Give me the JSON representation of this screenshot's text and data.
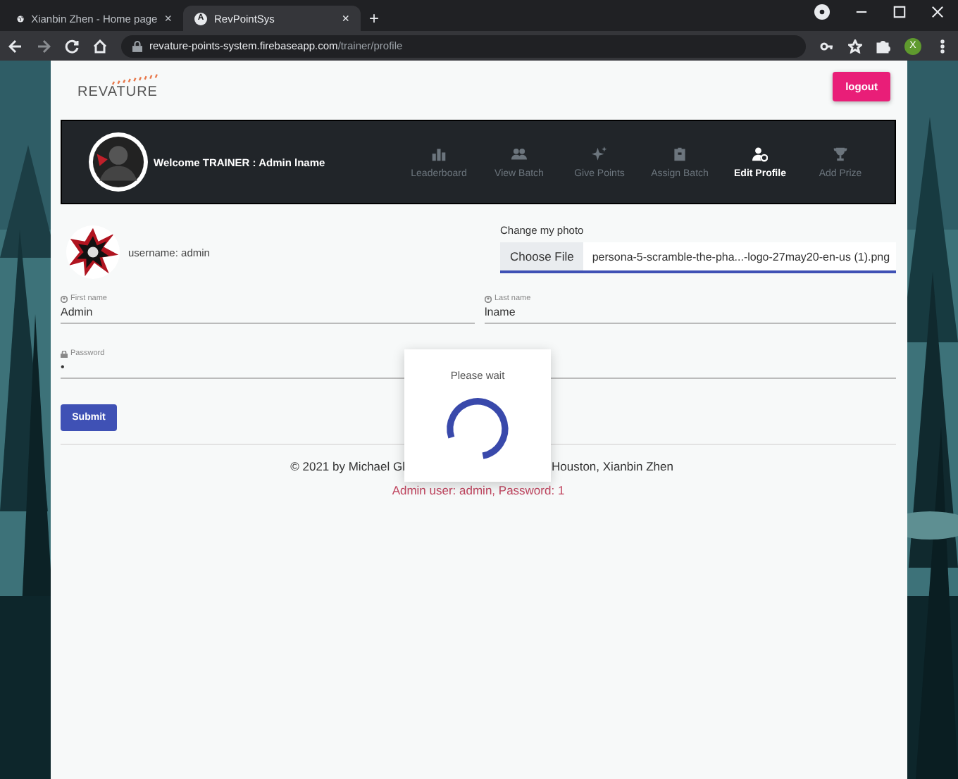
{
  "browser": {
    "tabs": [
      {
        "title": "Xianbin Zhen - Home page",
        "close": "×",
        "selected": false
      },
      {
        "title": "RevPointSys",
        "favicon": "A",
        "close": "×",
        "selected": true
      }
    ],
    "new_tab": "+",
    "url": {
      "host": "revature-points-system.firebaseapp.com",
      "path": "/trainer/profile"
    },
    "profile": "X"
  },
  "header": {
    "logo": "REVATURE",
    "logout": "logout"
  },
  "navbar": {
    "welcome": "Welcome TRAINER : Admin lname",
    "items": [
      {
        "label": "Leaderboard",
        "kind": "chart",
        "selected": false
      },
      {
        "label": "View Batch",
        "kind": "people",
        "selected": false
      },
      {
        "label": "Give Points",
        "kind": "sparkle",
        "selected": false
      },
      {
        "label": "Assign Batch",
        "kind": "clipboard",
        "selected": false
      },
      {
        "label": "Edit Profile",
        "kind": "person-gear",
        "selected": true
      },
      {
        "label": "Add Prize",
        "kind": "trophy",
        "selected": false
      }
    ]
  },
  "profile": {
    "username": "username: admin",
    "photo_label": "Change my photo",
    "choose_file": "Choose File",
    "file_name": "persona-5-scramble-the-pha...-logo-27may20-en-us (1).png"
  },
  "form": {
    "fields": [
      {
        "label": "First name",
        "value": "Admin",
        "kind": "text"
      },
      {
        "label": "Last name",
        "value": "lname",
        "kind": "text"
      },
      {
        "label": "Password",
        "value": "•",
        "kind": "password"
      }
    ],
    "submit": "Submit"
  },
  "footer": {
    "credit_start": "© 2021 by Michael Gl",
    "credit_end": "Houston, Xianbin Zhen",
    "hint": "Admin user: admin, Password: 1"
  },
  "dialog": {
    "message": "Please wait"
  }
}
